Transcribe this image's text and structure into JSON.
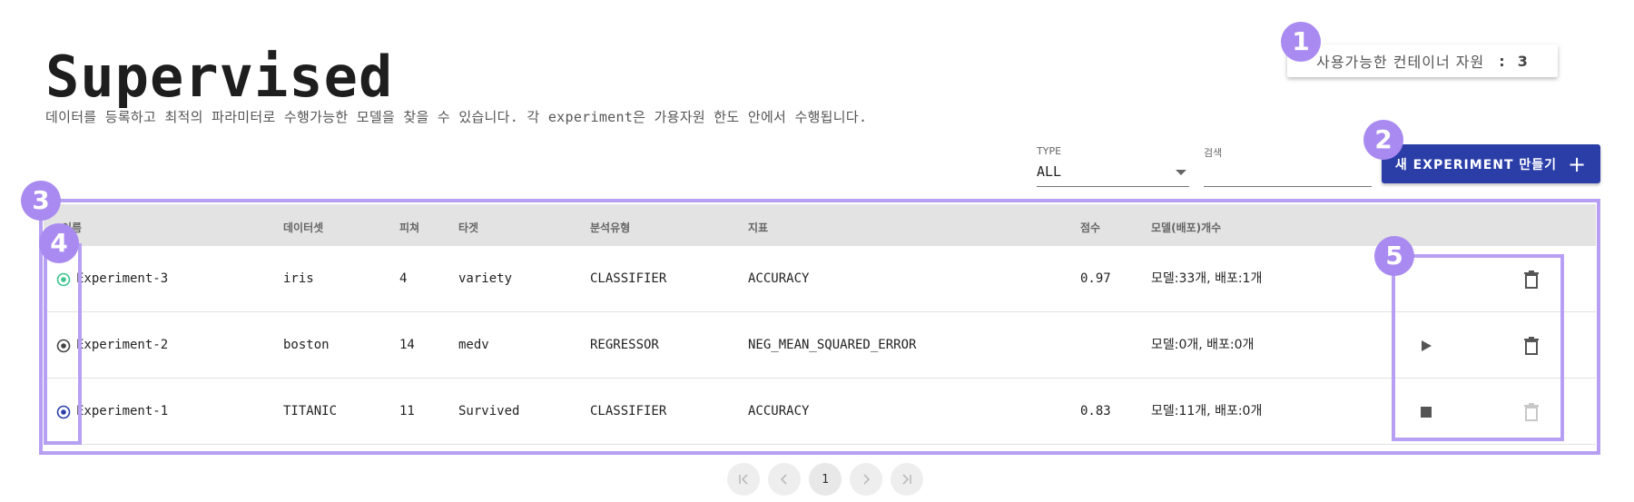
{
  "header": {
    "title": "Supervised",
    "description": "데이터를 등록하고 최적의 파라미터로 수행가능한 모델을 찾을 수 있습니다. 각 experiment은 가용자원 한도 안에서 수행됩니다."
  },
  "container": {
    "label": "사용가능한 컨테이너 자원",
    "separator": ":",
    "count": "3"
  },
  "filters": {
    "type_label": "TYPE",
    "type_value": "ALL",
    "search_label": "검색",
    "search_value": ""
  },
  "new_button": {
    "label": "새 EXPERIMENT 만들기",
    "icon": "plus-icon"
  },
  "markers": [
    "1",
    "2",
    "3",
    "4",
    "5"
  ],
  "table": {
    "headers": [
      "이름",
      "데이터셋",
      "피쳐",
      "타겟",
      "분석유형",
      "지표",
      "점수",
      "모델(배포)개수"
    ],
    "rows": [
      {
        "status": "running",
        "name": "Experiment-3",
        "dataset": "iris",
        "features": "4",
        "target": "variety",
        "type": "CLASSIFIER",
        "metric": "ACCURACY",
        "score": "0.97",
        "models": "모델:33개, 배포:1개",
        "action": "none",
        "delete_enabled": true
      },
      {
        "status": "idle",
        "name": "Experiment-2",
        "dataset": "boston",
        "features": "14",
        "target": "medv",
        "type": "REGRESSOR",
        "metric": "NEG_MEAN_SQUARED_ERROR",
        "score": "",
        "models": "모델:0개, 배포:0개",
        "action": "play",
        "delete_enabled": true
      },
      {
        "status": "active",
        "name": "Experiment-1",
        "dataset": "TITANIC",
        "features": "11",
        "target": "Survived",
        "type": "CLASSIFIER",
        "metric": "ACCURACY",
        "score": "0.83",
        "models": "모델:11개, 배포:0개",
        "action": "stop",
        "delete_enabled": false
      }
    ]
  },
  "pagination": {
    "current": "1"
  },
  "colors": {
    "accent": "#2b3ea8",
    "marker": "#a98af0",
    "running": "#3cc58f",
    "idle": "#444444",
    "active": "#2b3ea8"
  }
}
